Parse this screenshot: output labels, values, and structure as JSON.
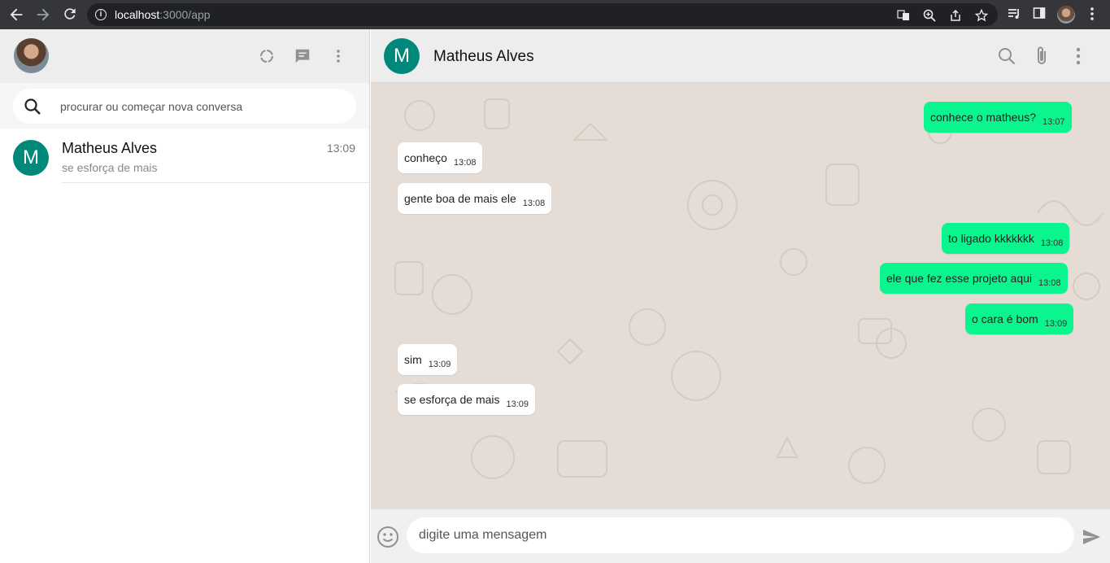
{
  "browser": {
    "url_host": "localhost",
    "url_rest": ":3000/app",
    "icons": [
      "back-arrow-icon",
      "forward-arrow-icon",
      "reload-icon",
      "info-icon",
      "translate-icon",
      "zoom-icon",
      "share-icon",
      "star-icon",
      "media-icon",
      "side-panel-icon",
      "profile-avatar",
      "menu-icon"
    ]
  },
  "sidebar": {
    "icons": [
      "status-icon",
      "new-chat-icon",
      "menu-icon"
    ],
    "search": {
      "placeholder": "procurar ou começar nova conversa"
    },
    "chats": [
      {
        "avatar_letter": "M",
        "name": "Matheus Alves",
        "time": "13:09",
        "last_message": "se esforça de mais"
      }
    ]
  },
  "chat": {
    "contact": {
      "avatar_letter": "M",
      "name": "Matheus Alves"
    },
    "header_icons": [
      "search-icon",
      "attach-icon",
      "menu-icon"
    ],
    "messages": [
      {
        "direction": "out",
        "text": "conhece o matheus?",
        "time": "13:07"
      },
      {
        "direction": "in",
        "text": "conheço",
        "time": "13:08"
      },
      {
        "direction": "in",
        "text": "gente boa de mais ele",
        "time": "13:08"
      },
      {
        "direction": "out",
        "text": "to ligado kkkkkkk",
        "time": "13:08"
      },
      {
        "direction": "out",
        "text": "ele que fez esse projeto aqui",
        "time": "13:08"
      },
      {
        "direction": "out",
        "text": "o cara é bom",
        "time": "13:09"
      },
      {
        "direction": "in",
        "text": "sim",
        "time": "13:09"
      },
      {
        "direction": "in",
        "text": "se esforça de mais",
        "time": "13:09"
      }
    ],
    "composer": {
      "placeholder": "digite uma mensagem"
    }
  },
  "colors": {
    "accent": "#00897b",
    "outgoing_bubble": "#0bf58f",
    "incoming_bubble": "#ffffff",
    "chat_background": "#e5ddd5",
    "header_background": "#ededed"
  }
}
